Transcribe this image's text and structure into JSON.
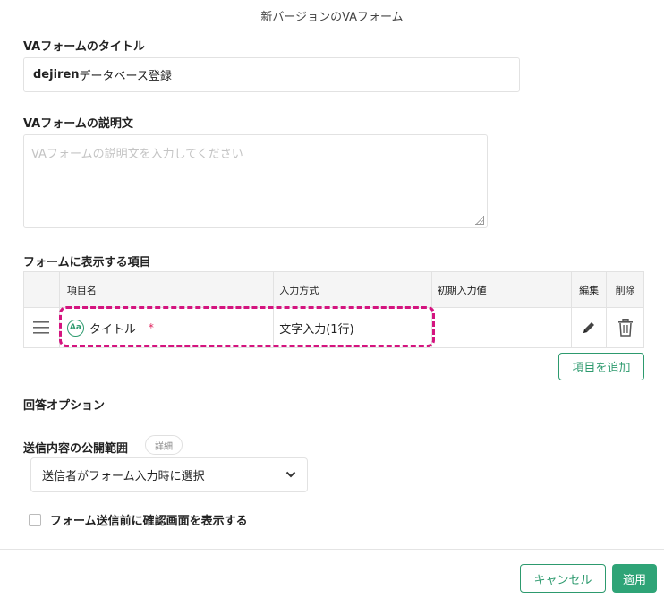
{
  "dialog": {
    "title": "新バージョンのVAフォーム"
  },
  "form_title": {
    "label": "VAフォームのタイトル",
    "value_bold": "dejiren",
    "value_rest": "データベース登録"
  },
  "description": {
    "label": "VAフォームの説明文",
    "placeholder": "VAフォームの説明文を入力してください"
  },
  "items": {
    "label": "フォームに表示する項目",
    "headers": {
      "name": "項目名",
      "method": "入力方式",
      "initial": "初期入力値",
      "edit": "編集",
      "delete": "削除"
    },
    "rows": [
      {
        "icon": "text-type-icon",
        "icon_text": "Aa",
        "name": "タイトル",
        "required_mark": "*",
        "method": "文字入力(1行)",
        "initial": ""
      }
    ],
    "add_button": "項目を追加"
  },
  "answer_options": {
    "label": "回答オプション",
    "scope_label": "送信内容の公開範囲",
    "detail_badge": "詳細",
    "scope_value": "送信者がフォーム入力時に選択",
    "confirm_label": "フォーム送信前に確認画面を表示する",
    "confirm_checked": false
  },
  "footer": {
    "cancel": "キャンセル",
    "apply": "適用"
  },
  "colors": {
    "accent": "#2fa477",
    "highlight": "#d4147f",
    "required": "#e0245e"
  }
}
